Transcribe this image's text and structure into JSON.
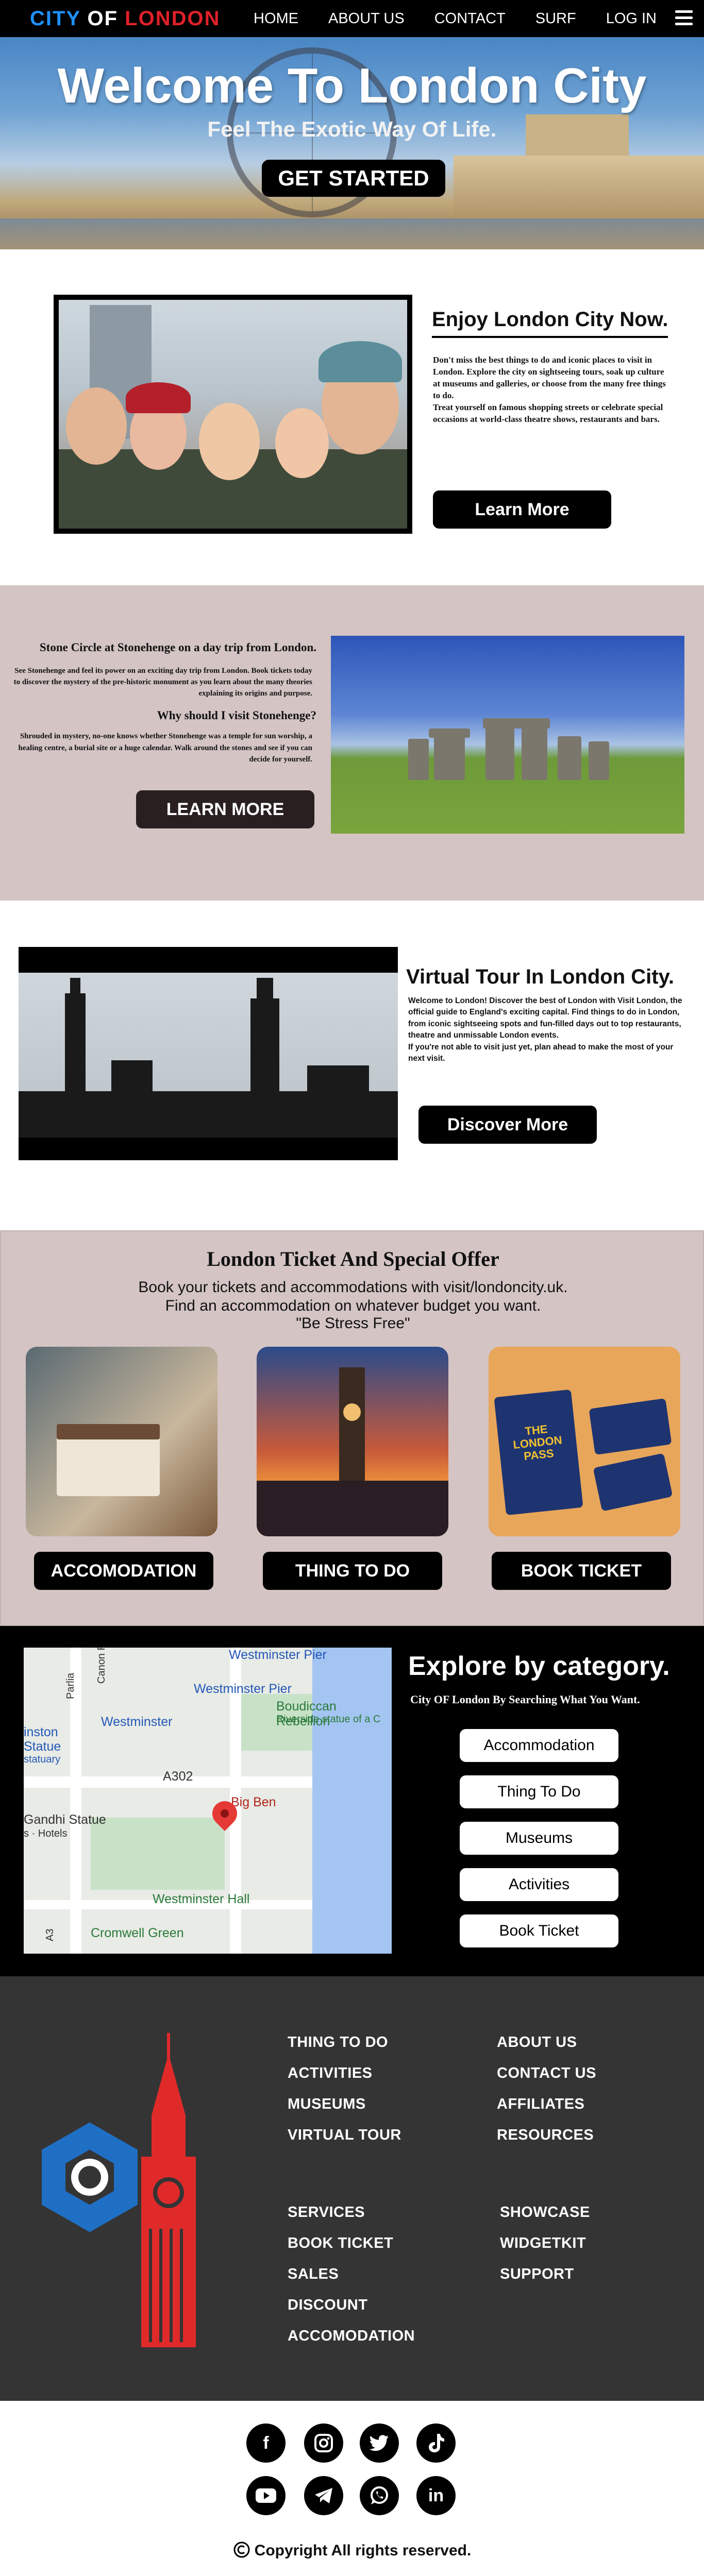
{
  "nav": {
    "logo": {
      "part1": "CITY",
      "part2": " OF ",
      "part3": "LONDON"
    },
    "links": [
      "HOME",
      "ABOUT US",
      "CONTACT",
      "SURF",
      "LOG IN"
    ]
  },
  "hero": {
    "title": "Welcome To London City",
    "subtitle": "Feel The Exotic Way Of Life.",
    "cta": "GET STARTED"
  },
  "enjoy": {
    "title": "Enjoy London City Now.",
    "p1": "Don't miss the best things to do and iconic places to visit in London. Explore the city on sightseeing tours, soak up culture at museums and galleries, or choose from the many free things to do.",
    "p2": "Treat yourself on famous shopping streets or celebrate special occasions at world-class theatre shows, restaurants and bars.",
    "button": "Learn More"
  },
  "stonehenge": {
    "heading": "Stone Circle at Stonehenge on a day trip from London.",
    "p1": "See Stonehenge and feel its power on an exciting day trip from London. Book tickets today to discover the mystery of the pre-historic monument as you learn about the many theories explaining its origins and purpose.",
    "heading2": "Why should I visit Stonehenge?",
    "p2": "Shrouded in mystery, no-one knows whether Stonehenge was a temple for sun worship, a healing centre, a burial site or a huge calendar. Walk around the stones and see if you can decide for yourself.",
    "button": "LEARN MORE"
  },
  "virtual_tour": {
    "title": "Virtual Tour In London City.",
    "p1": "Welcome to London! Discover the best of London with Visit London, the official guide to England's exciting capital. Find things to do in London, from iconic sightseeing spots and fun-filled days out to top restaurants, theatre and unmissable London events.",
    "p2": "If you're not able to visit just yet, plan ahead to make the most of your next visit.",
    "button": "Discover More"
  },
  "tickets": {
    "title": "London Ticket And Special Offer",
    "line1": "Book your tickets and accommodations with visit/londoncity.uk.",
    "line2": "Find an accommodation on whatever budget you want.",
    "line3": "\"Be Stress Free\"",
    "cards": [
      {
        "button": "ACCOMODATION"
      },
      {
        "button": "THING TO DO"
      },
      {
        "button": "BOOK TICKET",
        "pass_text1": "THE",
        "pass_text2": "LONDON",
        "pass_text3": "PASS"
      }
    ]
  },
  "explore": {
    "title": "Explore by category.",
    "subtitle": "City OF London By Searching What You Want.",
    "categories": [
      "Accommodation",
      "Thing To Do",
      "Museums",
      "Activities",
      "Book Ticket"
    ],
    "map_labels": {
      "westminster_pier1": "Westminster Pier",
      "westminster_pier2": "Westminster Pier",
      "westminster": "Westminster",
      "boudicca": "Boudiccan Rebellion",
      "riverside": "Riverside statue of a C",
      "road": "A302",
      "big_ben": "Big Ben",
      "statue_left1": "inston",
      "statue_left2": "Statue",
      "statue_left3": "statuary",
      "gandhi": "Gandhi Statue",
      "hotels": "s · Hotels",
      "westminster_hall": "Westminster Hall",
      "cromwell": "Cromwell Green",
      "canon_row": "Canon Row",
      "parliament": "Parlia",
      "a3": "A3"
    }
  },
  "footer": {
    "col1": [
      "THING TO DO",
      "ACTIVITIES",
      "MUSEUMS",
      "VIRTUAL TOUR"
    ],
    "col2": [
      "ABOUT US",
      "CONTACT US",
      "AFFILIATES",
      "RESOURCES"
    ],
    "col3": [
      "SERVICES",
      "BOOK TICKET",
      "SALES",
      "DISCOUNT",
      "ACCOMODATION"
    ],
    "col4": [
      "SHOWCASE",
      "WIDGETKIT",
      "SUPPORT"
    ],
    "social": [
      "facebook",
      "instagram",
      "twitter",
      "tiktok",
      "youtube",
      "telegram",
      "whatsapp",
      "linkedin"
    ],
    "copyright": "Copyright All rights reserved."
  },
  "colors": {
    "brand_blue": "#1e90ff",
    "brand_red": "#e0202a",
    "section_pink": "#d4c4c4",
    "footer_gray": "#343434"
  }
}
